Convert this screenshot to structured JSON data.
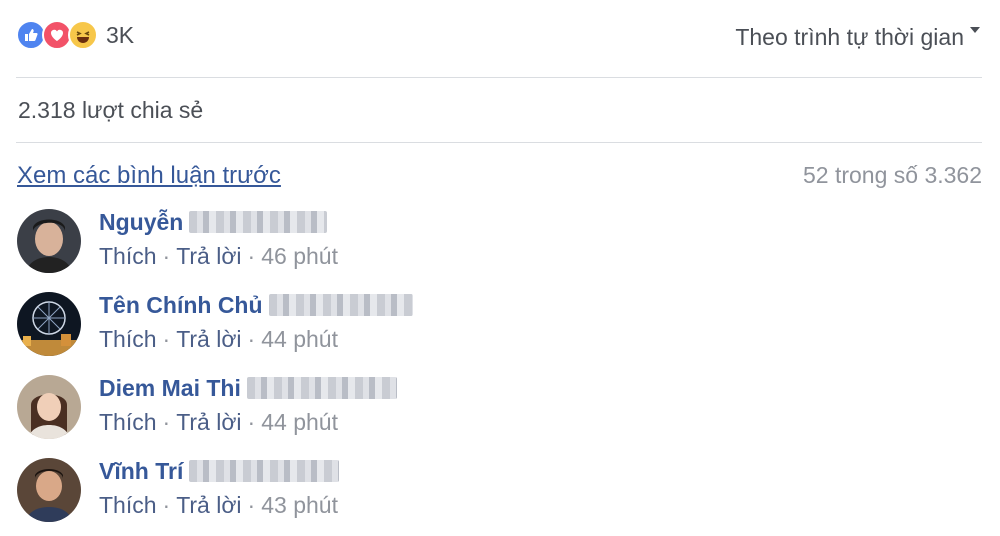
{
  "reactions": {
    "icons": [
      "like-icon",
      "love-icon",
      "haha-icon"
    ],
    "count": "3K"
  },
  "sort": {
    "label": "Theo trình tự thời gian"
  },
  "shares": {
    "text": "2.318 lượt chia sẻ"
  },
  "comments_header": {
    "prev_link": "Xem các bình luận trước",
    "count": "52 trong số 3.362"
  },
  "comments": [
    {
      "name": "Nguyễn",
      "like": "Thích",
      "reply": "Trả lời",
      "time": "46 phút"
    },
    {
      "name": "Tên Chính Chủ",
      "like": "Thích",
      "reply": "Trả lời",
      "time": "44 phút"
    },
    {
      "name": "Diem Mai Thi",
      "like": "Thích",
      "reply": "Trả lời",
      "time": "44 phút"
    },
    {
      "name": "Vĩnh Trí",
      "like": "Thích",
      "reply": "Trả lời",
      "time": "43 phút"
    }
  ],
  "separator": "·",
  "colors": {
    "link": "#365899",
    "meta": "#90949c",
    "like": "#4f84f0",
    "love": "#f25268",
    "haha": "#f7c74a"
  }
}
